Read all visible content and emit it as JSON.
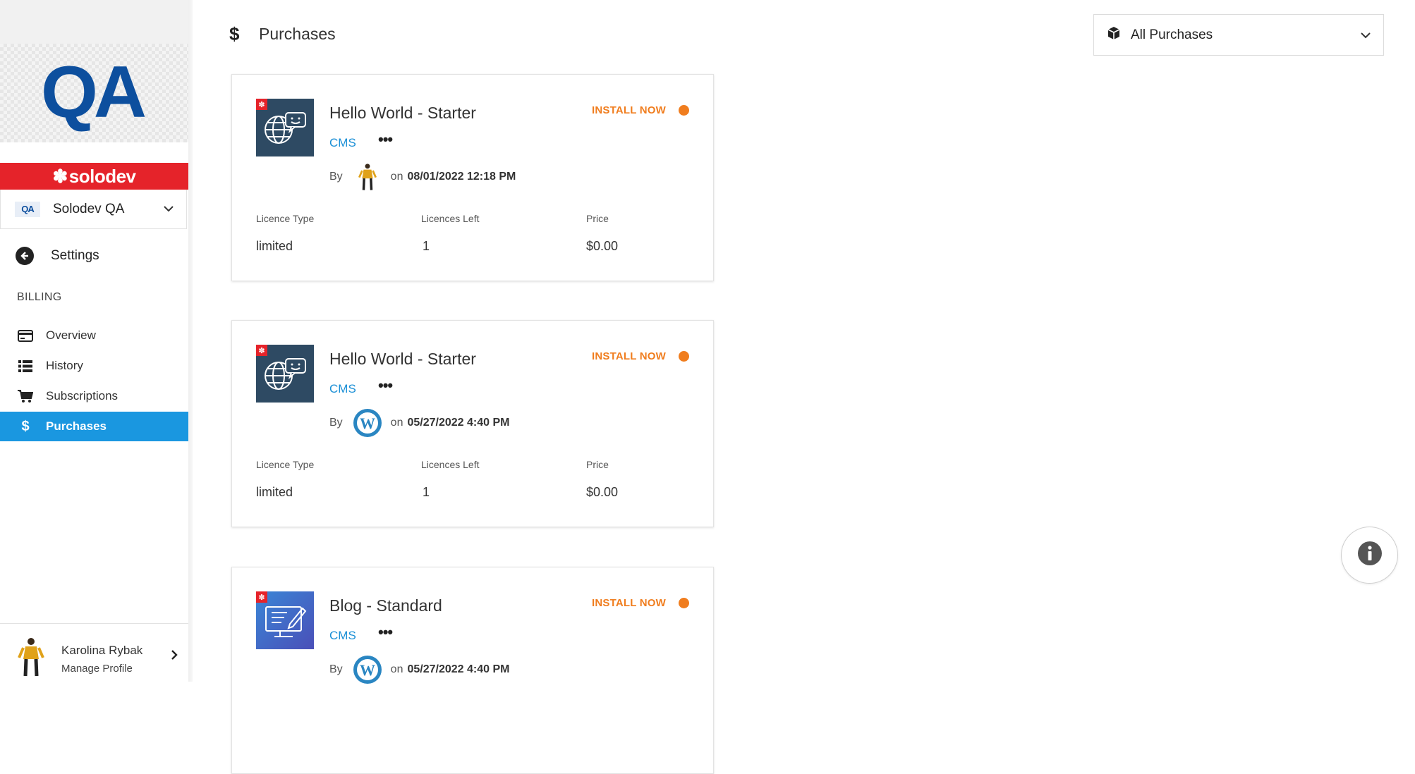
{
  "sidebar": {
    "logo_text": "QA",
    "brand_name": "solodev",
    "org": {
      "badge": "QA",
      "name": "Solodev QA"
    },
    "settings_label": "Settings",
    "section_title": "BILLING",
    "items": [
      {
        "label": "Overview",
        "icon": "credit-card-icon"
      },
      {
        "label": "History",
        "icon": "list-icon"
      },
      {
        "label": "Subscriptions",
        "icon": "cart-icon"
      },
      {
        "label": "Purchases",
        "icon": "dollar-icon",
        "active": true
      }
    ],
    "profile": {
      "name": "Karolina Rybak",
      "link": "Manage Profile"
    }
  },
  "header": {
    "icon": "$",
    "title": "Purchases"
  },
  "filter": {
    "label": "All Purchases",
    "icon": "box-icon"
  },
  "labels": {
    "licence_type": "Licence Type",
    "licences_left": "Licences Left",
    "price": "Price",
    "install": "INSTALL NOW",
    "by": "By",
    "on": "on",
    "more": "•••"
  },
  "purchases": [
    {
      "title": "Hello World - Starter",
      "category": "CMS",
      "author_avatar": "person-avatar",
      "date": "08/01/2022 12:18 PM",
      "licence_type": "limited",
      "licences_left": "1",
      "price": "$0.00",
      "icon": "globe-chat-icon"
    },
    {
      "title": "Hello World - Starter",
      "category": "CMS",
      "author_avatar": "wordpress-logo",
      "date": "05/27/2022 4:40 PM",
      "licence_type": "limited",
      "licences_left": "1",
      "price": "$0.00",
      "icon": "globe-chat-icon"
    },
    {
      "title": "Blog - Standard",
      "category": "CMS",
      "author_avatar": "wordpress-logo",
      "date": "05/27/2022 4:40 PM",
      "icon": "blog-monitor-icon"
    }
  ],
  "colors": {
    "accent": "#1a97e0",
    "install": "#f07d1e",
    "brand_red": "#e5232a",
    "logo_blue": "#0d4f9e"
  }
}
